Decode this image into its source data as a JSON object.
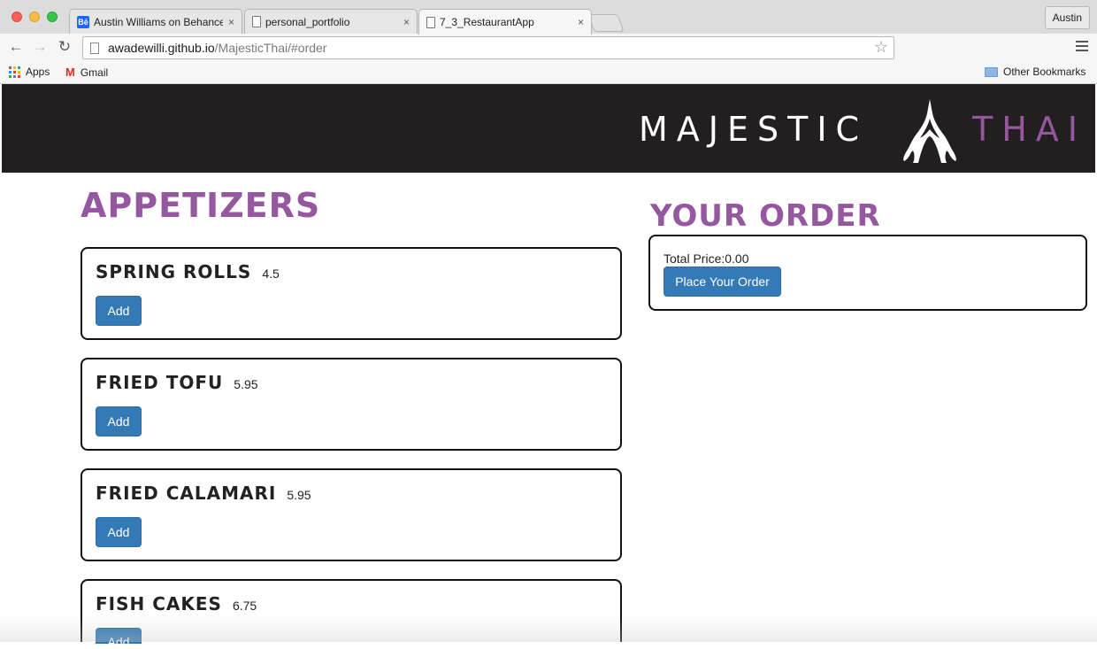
{
  "browser": {
    "tabs": [
      {
        "title": "Austin Williams on Behance",
        "icon": "behance-icon",
        "icon_text": "Bē"
      },
      {
        "title": "personal_portfolio",
        "icon": "page-icon"
      },
      {
        "title": "7_3_RestaurantApp",
        "icon": "page-icon",
        "active": true
      }
    ],
    "tab_close": "×",
    "profile_name": "Austin",
    "url_host": "awadewilli.github.io",
    "url_path": "/MajesticThai/#order",
    "bookmarks": [
      {
        "label": "Apps",
        "icon": "apps-grid-icon"
      },
      {
        "label": "Gmail",
        "icon": "gmail-icon",
        "icon_text": "M"
      }
    ],
    "other_bookmarks": "Other Bookmarks"
  },
  "site": {
    "brand_left": "MAJESTIC",
    "brand_right": "THAI",
    "accent_color": "#95579f",
    "header_color": "#231f20"
  },
  "menu": {
    "section_title": "APPETIZERS",
    "add_label": "Add",
    "items": [
      {
        "name": "SPRING ROLLS",
        "price": "4.5"
      },
      {
        "name": "FRIED TOFU",
        "price": "5.95"
      },
      {
        "name": "FRIED CALAMARI",
        "price": "5.95"
      },
      {
        "name": "FISH CAKES",
        "price": "6.75"
      }
    ]
  },
  "order": {
    "title": "YOUR ORDER",
    "total_label": "Total Price:",
    "total_value": "0.00",
    "place_label": "Place Your Order"
  }
}
